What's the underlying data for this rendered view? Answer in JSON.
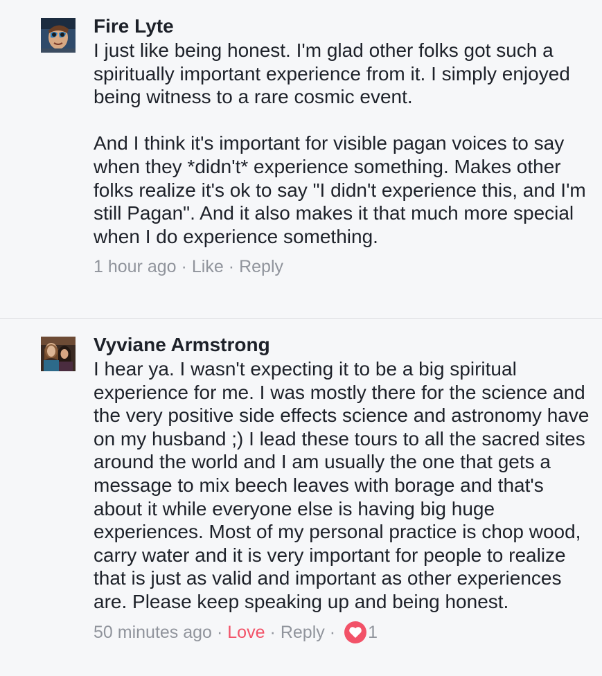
{
  "comments": [
    {
      "author": "Fire Lyte",
      "text": "I just like being honest. I'm glad other folks got such a spiritually important experience from it. I simply enjoyed being witness to a rare cosmic event.\n\nAnd I think it's important for visible pagan voices to say when they *didn't* experience something. Makes other folks realize it's ok to say \"I didn't experience this, and I'm still Pagan\". And it also makes it that much more special when I do experience something.",
      "time": "1 hour ago",
      "like_label": "Like",
      "reply_label": "Reply",
      "separator": "·"
    },
    {
      "author": "Vyviane Armstrong",
      "text": "I hear ya. I wasn't expecting it to be a big spiritual experience for me. I was mostly there for the science and the very positive side effects science and astronomy have on my husband ;) I lead these tours to all the sacred sites around the world and I am usually the one that gets a message to mix beech leaves with borage and that's about it while everyone else is having big huge experiences. Most of my personal practice is chop wood, carry water and it is very important for people to realize that is just as valid and important as other experiences are. Please keep speaking up and being honest.",
      "time": "50 minutes ago",
      "love_label": "Love",
      "reply_label": "Reply",
      "reaction_count": "1",
      "separator": "·",
      "reaction_icon": "heart-icon"
    }
  ],
  "colors": {
    "background": "#f6f7f9",
    "text": "#1d2129",
    "meta": "#90949c",
    "love": "#f25268",
    "divider": "#dddfe2"
  }
}
